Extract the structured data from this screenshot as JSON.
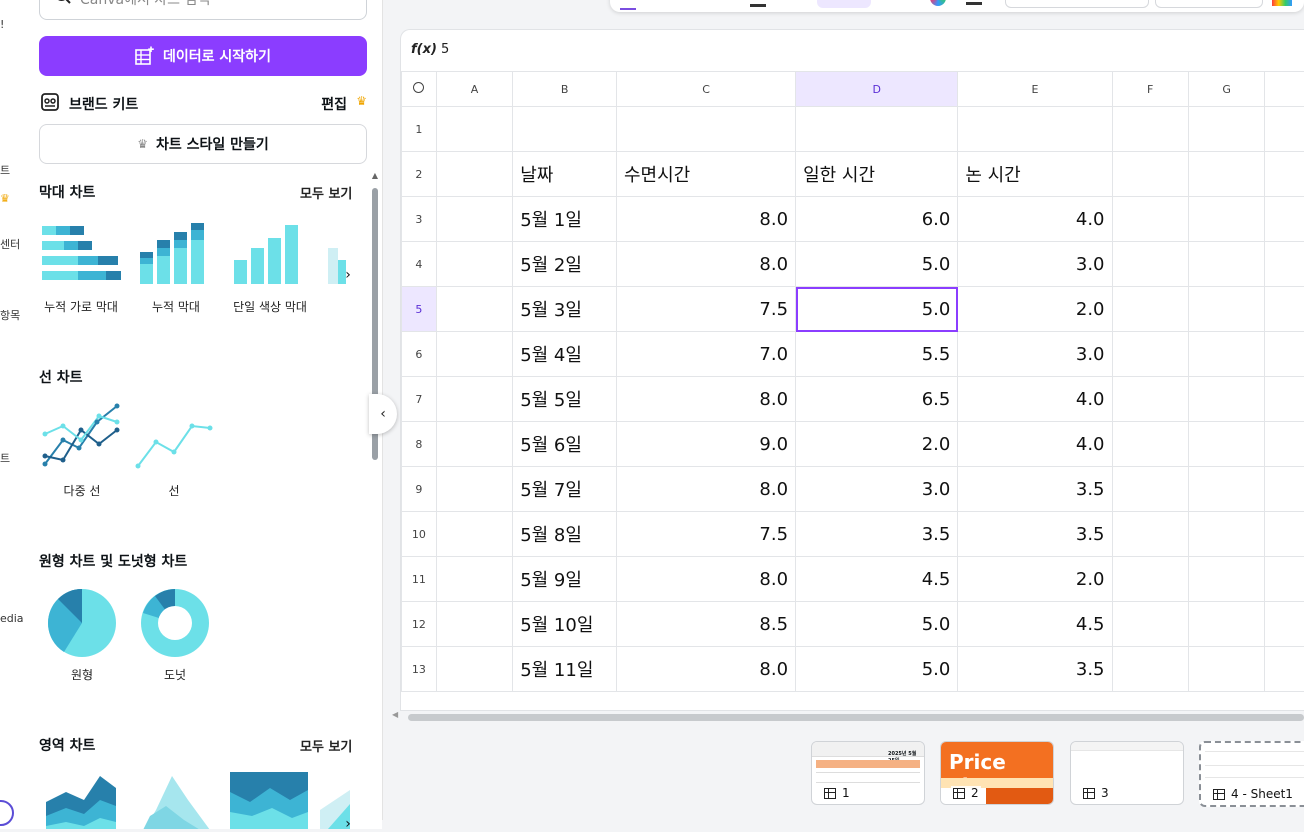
{
  "rail": {
    "labels": [
      "!",
      "트",
      "센터",
      "항목",
      "트",
      "edia"
    ]
  },
  "panel": {
    "search_placeholder": "Canva에서 차트 검색",
    "start_with_data": "데이터로 시작하기",
    "brand_kit": "브랜드 키트",
    "edit": "편집",
    "create_chart_style": "차트 스타일 만들기",
    "sections": {
      "bar": {
        "title": "막대 차트",
        "see_all": "모두 보기",
        "items": [
          "누적 가로 막대",
          "누적 막대",
          "단일 색상 막대"
        ]
      },
      "line": {
        "title": "선 차트",
        "items": [
          "다중 선",
          "선"
        ]
      },
      "pie": {
        "title": "원형 차트 및 도넛형 차트",
        "items": [
          "원형",
          "도넛"
        ]
      },
      "area": {
        "title": "영역 차트",
        "see_all": "모두 보기"
      }
    }
  },
  "colors": {
    "primary": "#8b3dff",
    "chart_light": "#6ce0e8",
    "chart_mid": "#3db4d4",
    "chart_dark": "#2780ab"
  },
  "sheet": {
    "formula_label": "f(x)",
    "formula_value": "5",
    "columns": [
      "A",
      "B",
      "C",
      "D",
      "E",
      "F",
      "G"
    ],
    "headers": {
      "date": "날짜",
      "sleep": "수면시간",
      "work": "일한 시간",
      "play": "논 시간"
    },
    "rows": [
      {
        "n": "3",
        "date": "5월 1일",
        "sleep": "8.0",
        "work": "6.0",
        "play": "4.0"
      },
      {
        "n": "4",
        "date": "5월 2일",
        "sleep": "8.0",
        "work": "5.0",
        "play": "3.0"
      },
      {
        "n": "5",
        "date": "5월 3일",
        "sleep": "7.5",
        "work": "5.0",
        "play": "2.0"
      },
      {
        "n": "6",
        "date": "5월 4일",
        "sleep": "7.0",
        "work": "5.5",
        "play": "3.0"
      },
      {
        "n": "7",
        "date": "5월 5일",
        "sleep": "8.0",
        "work": "6.5",
        "play": "4.0"
      },
      {
        "n": "8",
        "date": "5월 6일",
        "sleep": "9.0",
        "work": "2.0",
        "play": "4.0"
      },
      {
        "n": "9",
        "date": "5월 7일",
        "sleep": "8.0",
        "work": "3.0",
        "play": "3.5"
      },
      {
        "n": "10",
        "date": "5월 8일",
        "sleep": "7.5",
        "work": "3.5",
        "play": "3.5"
      },
      {
        "n": "11",
        "date": "5월 9일",
        "sleep": "8.0",
        "work": "4.5",
        "play": "2.0"
      },
      {
        "n": "12",
        "date": "5월 10일",
        "sleep": "8.5",
        "work": "5.0",
        "play": "4.5"
      },
      {
        "n": "13",
        "date": "5월 11일",
        "sleep": "8.0",
        "work": "5.0",
        "play": "3.5"
      }
    ]
  },
  "pages": [
    {
      "label": "1",
      "thumb_text": "2025년 5월 25일"
    },
    {
      "label": "2",
      "thumb_text": "Price List"
    },
    {
      "label": "3"
    },
    {
      "label": "4 - Sheet1"
    }
  ]
}
